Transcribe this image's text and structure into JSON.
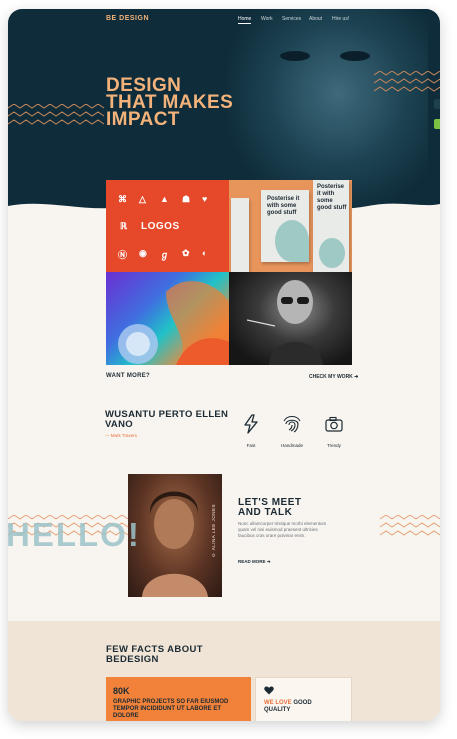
{
  "header": {
    "logo": "BE DESIGN",
    "nav": [
      "Home",
      "Work",
      "Services",
      "About",
      "Hire us!"
    ],
    "active_nav": "Home"
  },
  "hero": {
    "headline_lines": [
      "DESIGN",
      "THAT MAKES",
      "IMPACT"
    ]
  },
  "portfolio": {
    "logos_label": "LOGOS",
    "poster_text_1": "Posterise it with some good stuff",
    "poster_text_2": "Posterise it with some good stuff",
    "want_more": "WANT MORE?",
    "check_work": "CHECK MY WORK ➜"
  },
  "quote": {
    "title": "WUSANTU PERTO ELLEN VANO",
    "author": "— Mark Travers"
  },
  "features": [
    {
      "label": "Fast",
      "icon": "lightning-icon"
    },
    {
      "label": "Handmade",
      "icon": "fingerprint-icon"
    },
    {
      "label": "Trendy",
      "icon": "camera-icon"
    }
  ],
  "meet": {
    "hello": "HELLO!",
    "title_line1": "LET'S MEET",
    "title_line2": "AND TALK",
    "text": "Nunc ullamcorper tristique morbi elementum quam vel nisi euismod praesent ultricies faucibus cras orare pulvinar enim.",
    "read_more": "READ MORE ➜",
    "photo_caption": "© ALINA LEE JONES"
  },
  "facts": {
    "title_line1": "FEW FACTS ABOUT",
    "title_line2": "BEDESIGN",
    "card1_number": "80K",
    "card1_text": "GRAPHIC PROJECTS SO FAR EIUSMOD TEMPOR INCIDIDUNT UT LABORE ET DOLORE",
    "card2_prefix": "WE LOVE",
    "card2_mid": "GOOD",
    "card2_suffix": "QUALITY"
  },
  "colors": {
    "navy": "#0f2c3a",
    "orange": "#f2823a",
    "peach": "#f2b27a",
    "cream": "#f8f4ef",
    "teal": "#9cc3c9"
  }
}
